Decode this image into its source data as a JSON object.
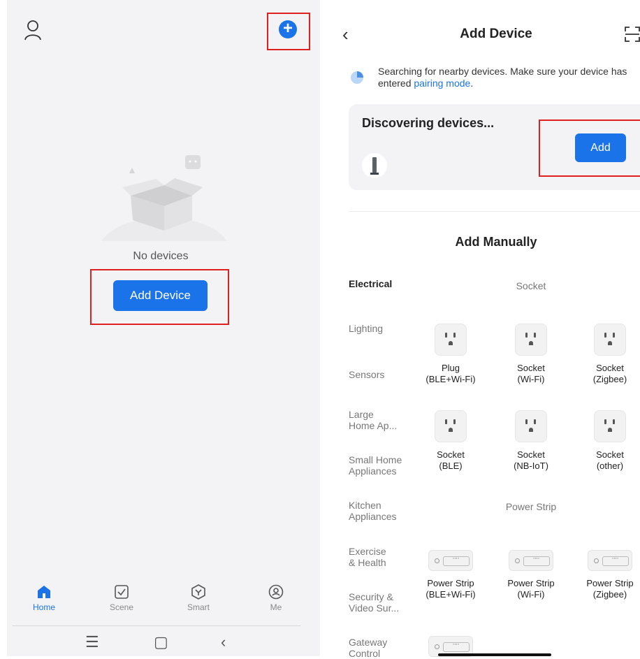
{
  "left": {
    "empty_text": "No devices",
    "add_device_label": "Add Device",
    "tabs": [
      {
        "label": "Home"
      },
      {
        "label": "Scene"
      },
      {
        "label": "Smart"
      },
      {
        "label": "Me"
      }
    ]
  },
  "right": {
    "title": "Add Device",
    "search_msg_prefix": "Searching for nearby devices. Make sure your device has entered ",
    "search_msg_link": "pairing mode",
    "search_msg_suffix": ".",
    "discover_title": "Discovering devices...",
    "add_label": "Add",
    "manual_title": "Add Manually",
    "categories": [
      {
        "label": "Electrical"
      },
      {
        "label": "Lighting"
      },
      {
        "label": "Sensors"
      },
      {
        "label": "Large Home Ap..."
      },
      {
        "label": "Small Home Appliances"
      },
      {
        "label": "Kitchen Appliances"
      },
      {
        "label": "Exercise & Health"
      },
      {
        "label": "Security & Video Sur..."
      },
      {
        "label": "Gateway Control"
      }
    ],
    "socket_section": "Socket",
    "socket_tiles": [
      {
        "name": "Plug",
        "sub": "(BLE+Wi-Fi)"
      },
      {
        "name": "Socket",
        "sub": "(Wi-Fi)"
      },
      {
        "name": "Socket",
        "sub": "(Zigbee)"
      },
      {
        "name": "Socket",
        "sub": "(BLE)"
      },
      {
        "name": "Socket",
        "sub": "(NB-IoT)"
      },
      {
        "name": "Socket",
        "sub": "(other)"
      }
    ],
    "strip_section": "Power Strip",
    "strip_tiles": [
      {
        "name": "Power Strip",
        "sub": "(BLE+Wi-Fi)"
      },
      {
        "name": "Power Strip",
        "sub": "(Wi-Fi)"
      },
      {
        "name": "Power Strip",
        "sub": "(Zigbee)"
      }
    ]
  },
  "colors": {
    "accent": "#1a73e8",
    "highlight": "#e0201f"
  },
  "icons": [
    "user-icon",
    "plus-icon",
    "home-icon",
    "scene-icon",
    "smart-icon",
    "me-icon",
    "back-icon",
    "scan-icon",
    "spinner-icon",
    "socket-icon",
    "power-strip-icon"
  ]
}
